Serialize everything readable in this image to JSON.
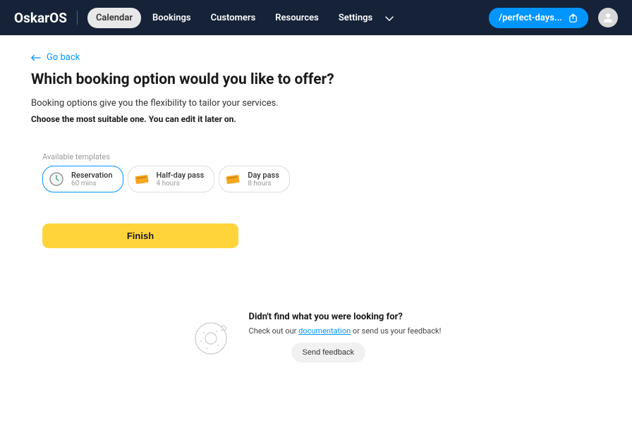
{
  "header": {
    "logo": "OskarOS",
    "nav": {
      "calendar": "Calendar",
      "bookings": "Bookings",
      "customers": "Customers",
      "resources": "Resources",
      "settings": "Settings"
    },
    "pill_label": "/perfect-days..."
  },
  "back": {
    "label": "Go back"
  },
  "page": {
    "title": "Which booking option would you like to offer?",
    "subtitle": "Booking options give you the flexibility to tailor your services.",
    "note": "Choose the most suitable one. You can edit it later on."
  },
  "templates": {
    "heading": "Available templates",
    "items": [
      {
        "title": "Reservation",
        "sub": "60 mins",
        "icon": "clock",
        "selected": true
      },
      {
        "title": "Half-day pass",
        "sub": "4 hours",
        "icon": "ticket",
        "selected": false
      },
      {
        "title": "Day pass",
        "sub": "8 hours",
        "icon": "ticket",
        "selected": false
      }
    ]
  },
  "finish": {
    "label": "Finish"
  },
  "feedback": {
    "title": "Didn't find what you were looking for?",
    "prefix": "Check out our ",
    "link": "documentation",
    "suffix": " or send us your feedback!",
    "button": "Send feedback"
  }
}
